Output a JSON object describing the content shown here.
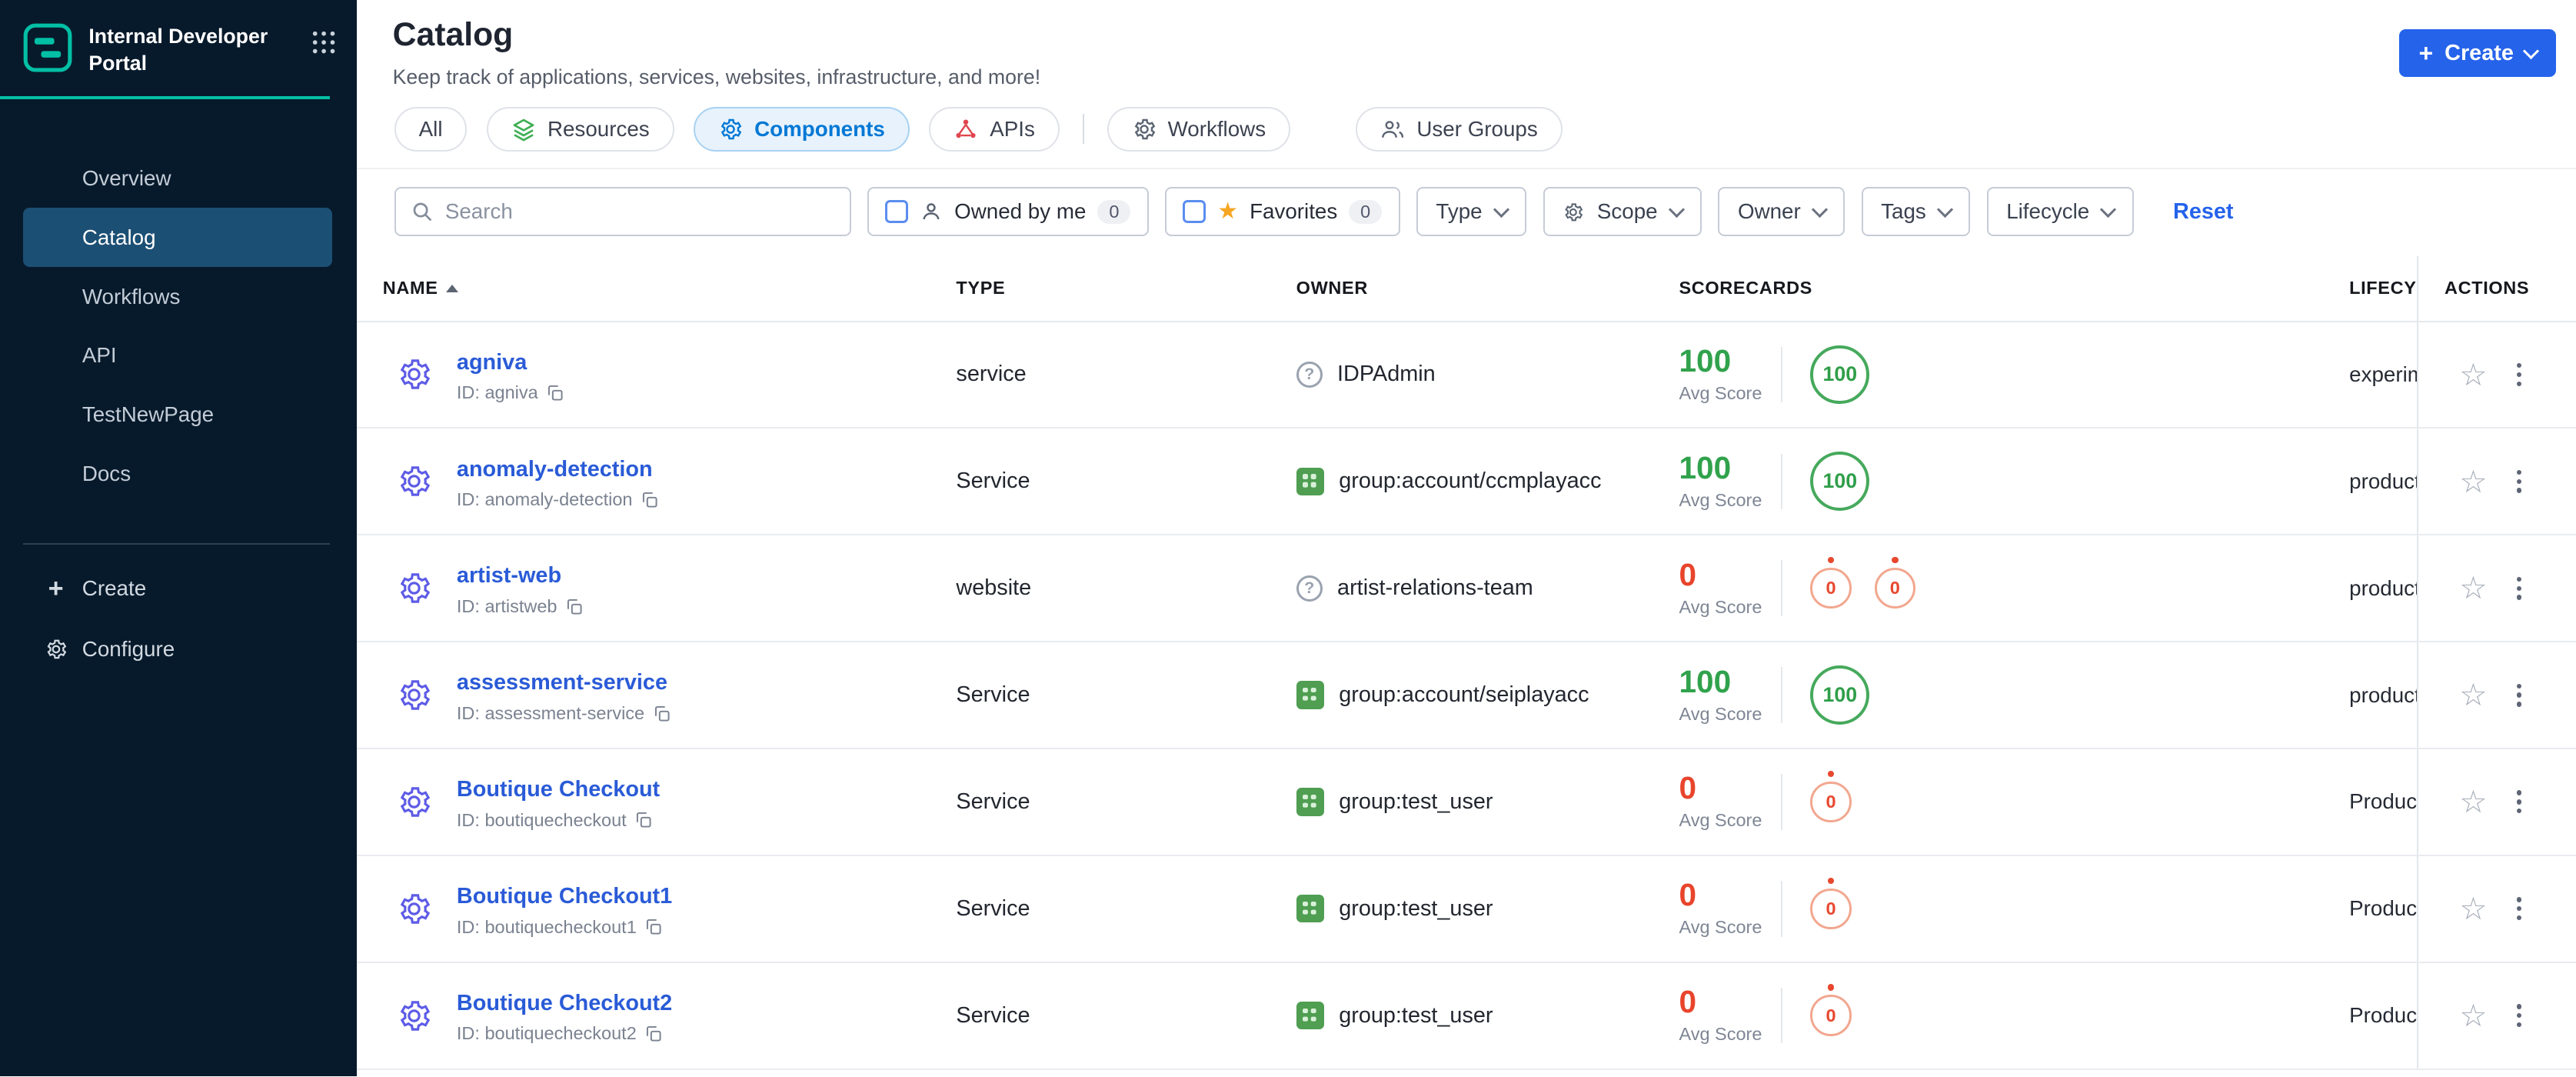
{
  "colors": {
    "sidebar_bg": "#071A2B",
    "sidebar_active_bg": "#1C4F74",
    "accent_teal": "#02BFA5",
    "primary_blue": "#2563EB",
    "link_blue": "#2A5BD7",
    "tab_active_blue": "#0278D5",
    "score_green": "#31A24C",
    "score_red": "#E8452C",
    "owner_group_green": "#4F9E52"
  },
  "sidebar": {
    "brand": "Internal Developer Portal",
    "items": [
      {
        "label": "Overview"
      },
      {
        "label": "Catalog",
        "active": true
      },
      {
        "label": "Workflows"
      },
      {
        "label": "API"
      },
      {
        "label": "TestNewPage"
      },
      {
        "label": "Docs"
      }
    ],
    "create_label": "Create",
    "configure_label": "Configure"
  },
  "header": {
    "title": "Catalog",
    "subtitle": "Keep track of applications, services, websites, infrastructure, and more!",
    "create_button": "Create"
  },
  "tabs": [
    {
      "label": "All"
    },
    {
      "label": "Resources",
      "icon": "layers-icon"
    },
    {
      "label": "Components",
      "icon": "gear-icon",
      "active": true
    },
    {
      "label": "APIs",
      "icon": "api-icon"
    },
    {
      "label": "Workflows",
      "icon": "workflow-icon"
    },
    {
      "label": "User Groups",
      "icon": "user-group-icon"
    }
  ],
  "filters": {
    "search_placeholder": "Search",
    "owned_by_me": {
      "label": "Owned by me",
      "count": "0",
      "icon": "person-icon"
    },
    "favorites": {
      "label": "Favorites",
      "count": "0",
      "icon": "star-icon"
    },
    "dropdowns": [
      {
        "label": "Type"
      },
      {
        "label": "Scope",
        "icon": "gear-icon"
      },
      {
        "label": "Owner"
      },
      {
        "label": "Tags"
      },
      {
        "label": "Lifecycle"
      }
    ],
    "reset_label": "Reset"
  },
  "table": {
    "columns": [
      "NAME",
      "TYPE",
      "OWNER",
      "SCORECARDS",
      "LIFECYCLE",
      "ACTIONS"
    ],
    "sort": {
      "column": "NAME",
      "direction": "asc"
    },
    "avg_score_label": "Avg Score",
    "rows": [
      {
        "name": "agniva",
        "entity_id": "ID: agniva",
        "type": "service",
        "owner": "IDPAdmin",
        "owner_icon": "question-icon",
        "avg_score": "100",
        "score_style": "green",
        "badge1": {
          "value": "100",
          "style": "green"
        },
        "lifecycle": "experimental"
      },
      {
        "name": "anomaly-detection",
        "entity_id": "ID: anomaly-detection",
        "type": "Service",
        "owner": "group:account/ccmplayacc",
        "owner_icon": "group-icon",
        "avg_score": "100",
        "score_style": "green",
        "badge1": {
          "value": "100",
          "style": "green"
        },
        "lifecycle": "production"
      },
      {
        "name": "artist-web",
        "entity_id": "ID: artistweb",
        "type": "website",
        "owner": "artist-relations-team",
        "owner_icon": "question-icon",
        "avg_score": "0",
        "score_style": "red",
        "badge1": {
          "value": "0",
          "style": "orange"
        },
        "badge2": {
          "value": "0",
          "style": "orange"
        },
        "lifecycle": "production"
      },
      {
        "name": "assessment-service",
        "entity_id": "ID: assessment-service",
        "type": "Service",
        "owner": "group:account/seiplayacc",
        "owner_icon": "group-icon",
        "avg_score": "100",
        "score_style": "green",
        "badge1": {
          "value": "100",
          "style": "green"
        },
        "lifecycle": "production"
      },
      {
        "name": "Boutique Checkout",
        "entity_id": "ID: boutiquecheckout",
        "type": "Service",
        "owner": "group:test_user",
        "owner_icon": "group-icon",
        "avg_score": "0",
        "score_style": "red",
        "badge1": {
          "value": "0",
          "style": "orange"
        },
        "lifecycle": "Production"
      },
      {
        "name": "Boutique Checkout1",
        "entity_id": "ID: boutiquecheckout1",
        "type": "Service",
        "owner": "group:test_user",
        "owner_icon": "group-icon",
        "avg_score": "0",
        "score_style": "red",
        "badge1": {
          "value": "0",
          "style": "orange"
        },
        "lifecycle": "Production"
      },
      {
        "name": "Boutique Checkout2",
        "entity_id": "ID: boutiquecheckout2",
        "type": "Service",
        "owner": "group:test_user",
        "owner_icon": "group-icon",
        "avg_score": "0",
        "score_style": "red",
        "badge1": {
          "value": "0",
          "style": "orange"
        },
        "lifecycle": "Production"
      }
    ]
  }
}
